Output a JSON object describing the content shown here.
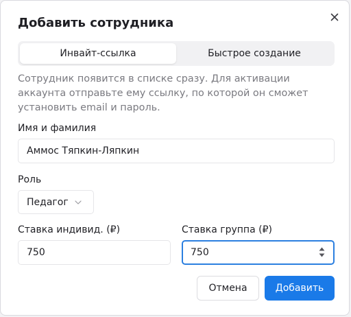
{
  "dialog": {
    "title": "Добавить сотрудника",
    "close_icon": "close-icon"
  },
  "tabs": [
    {
      "label": "Инвайт-ссылка",
      "active": true
    },
    {
      "label": "Быстрое создание",
      "active": false
    }
  ],
  "description": "Сотрудник появится в списке сразу. Для активации аккаунта отправьте ему ссылку, по которой он сможет установить email и пароль.",
  "form": {
    "name_label": "Имя и фамилия",
    "name_value": "Аммос Тяпкин-Ляпкин",
    "role_label": "Роль",
    "role_value": "Педагог",
    "rate_individual_label": "Ставка индивид. (₽)",
    "rate_individual_value": "750",
    "rate_group_label": "Ставка группа (₽)",
    "rate_group_value": "750"
  },
  "actions": {
    "cancel_label": "Отмена",
    "submit_label": "Добавить"
  },
  "colors": {
    "accent": "#1a7ae8",
    "focus_ring": "#2b7fe0"
  }
}
